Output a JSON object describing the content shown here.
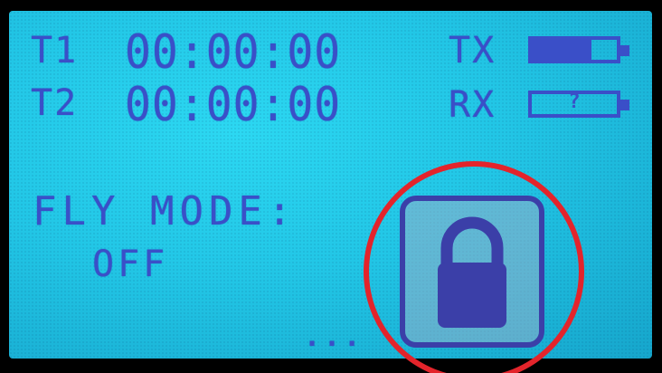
{
  "timers": [
    {
      "label": "T1",
      "time": "00:00:00"
    },
    {
      "label": "T2",
      "time": "00:00:00"
    }
  ],
  "telemetry": {
    "tx": {
      "label": "TX",
      "level": 0.7
    },
    "rx": {
      "label": "RX",
      "status": "?",
      "level": 0
    }
  },
  "fly_mode": {
    "label": "FLY MODE:",
    "value": "OFF"
  },
  "page_indicator": "...",
  "lock": {
    "icon": "lock-icon",
    "state": "locked"
  },
  "colors": {
    "screen": "#22c6e6",
    "text": "#3a4fc8",
    "lock": "#3b3fa8",
    "highlight": "#e3242b"
  }
}
